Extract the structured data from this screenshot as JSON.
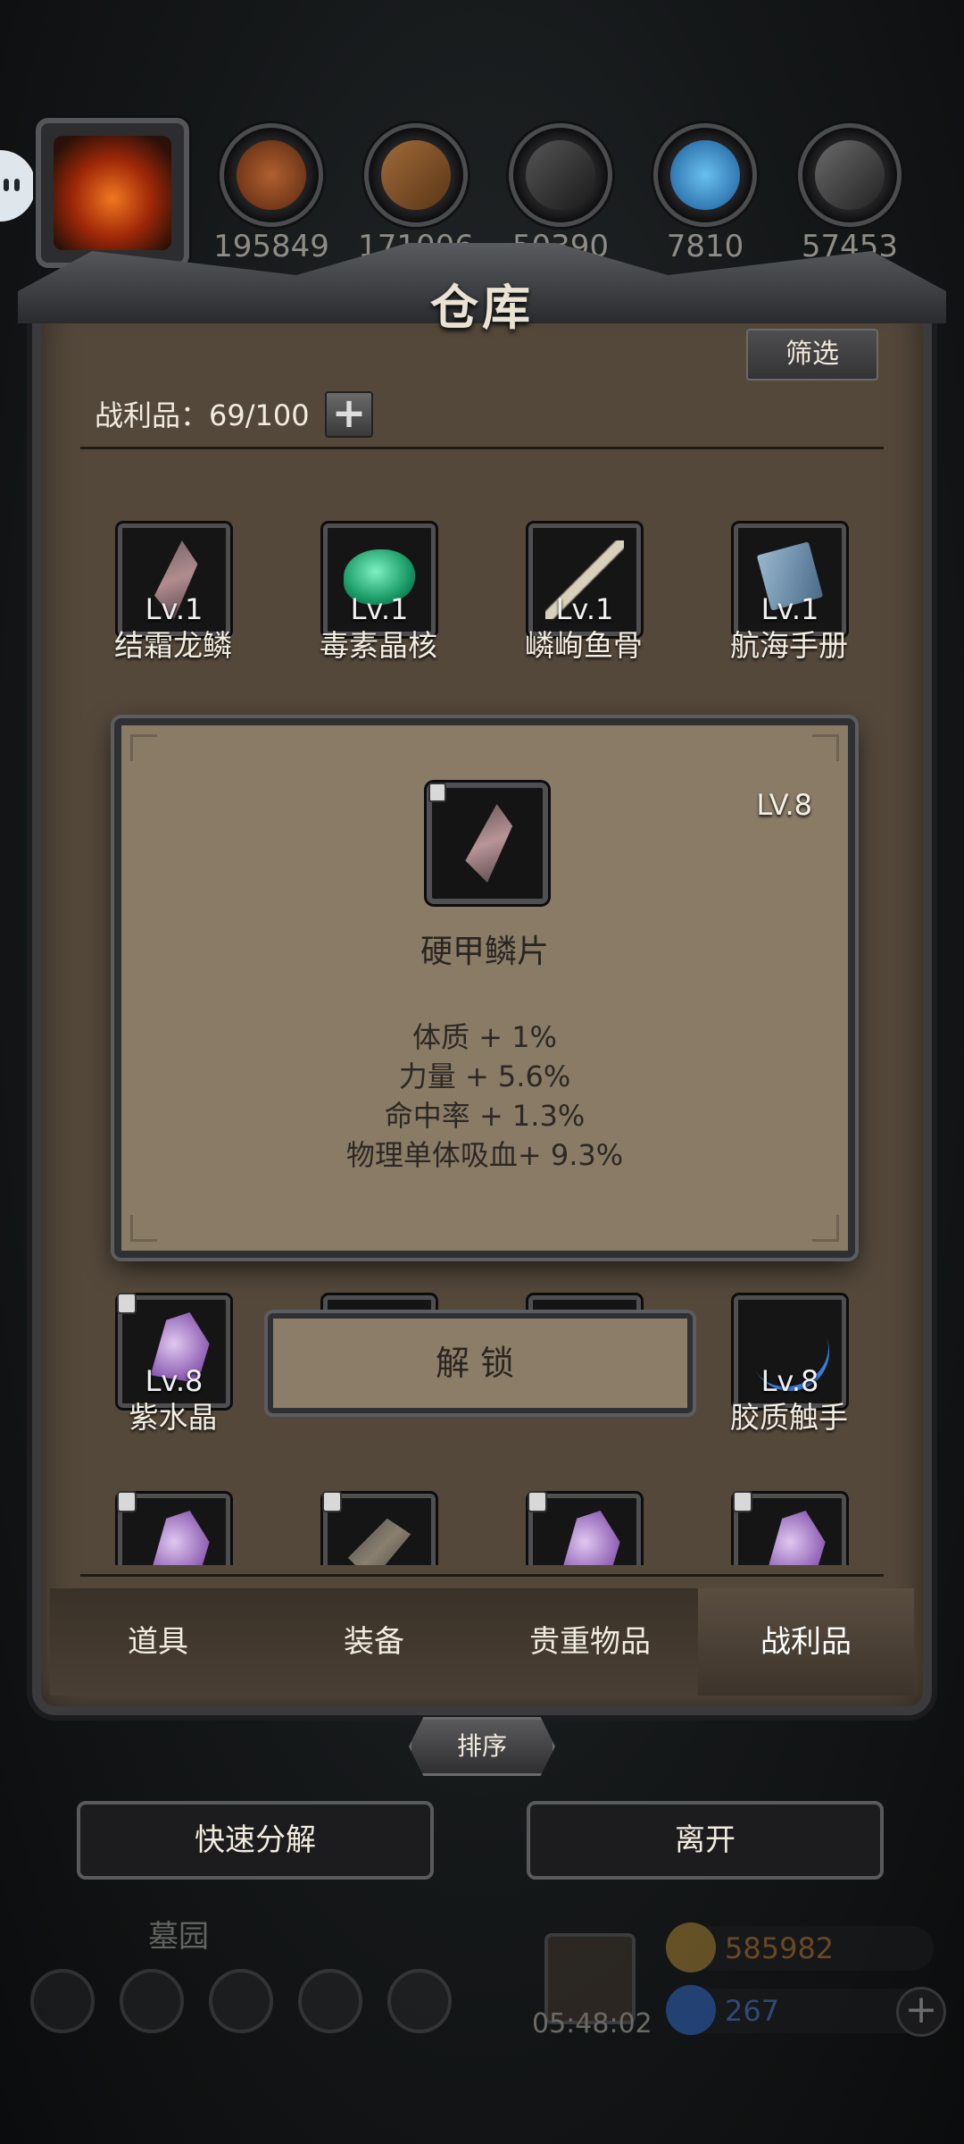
{
  "resources": [
    {
      "name": "wood-icon",
      "count": "195849",
      "color": "#a0522d"
    },
    {
      "name": "plank-icon",
      "count": "171006",
      "color": "#8b5a2b"
    },
    {
      "name": "iron-icon",
      "count": "50390",
      "color": "#666666"
    },
    {
      "name": "crystal-icon",
      "count": "7810",
      "color": "#3a8fd0"
    },
    {
      "name": "ingot-icon",
      "count": "57453",
      "color": "#5a5a5a"
    }
  ],
  "panel": {
    "title": "仓库",
    "filter_label": "筛选",
    "loot_count": "战利品：69/100"
  },
  "items_row1": [
    {
      "level": "Lv.1",
      "name": "结霜龙鳞",
      "icon": "scale-icon"
    },
    {
      "level": "Lv.1",
      "name": "毒素晶核",
      "icon": "jade-core-icon"
    },
    {
      "level": "Lv.1",
      "name": "嶙峋鱼骨",
      "icon": "fishbone-icon"
    },
    {
      "level": "Lv.1",
      "name": "航海手册",
      "icon": "book-icon"
    }
  ],
  "items_row3": [
    {
      "level": "Lv.8",
      "name": "紫水晶",
      "icon": "amethyst-icon"
    },
    {
      "level": "",
      "name": "",
      "icon": ""
    },
    {
      "level": "",
      "name": "",
      "icon": ""
    },
    {
      "level": "Lv.8",
      "name": "胶质触手",
      "icon": "tentacle-icon"
    }
  ],
  "tooltip": {
    "level": "LV.8",
    "name": "硬甲鳞片",
    "stats": [
      "体质 + 1%",
      "力量 + 5.6%",
      "命中率 + 1.3%",
      "物理单体吸血+ 9.3%"
    ]
  },
  "unlock_label": "解锁",
  "tabs": [
    "道具",
    "装备",
    "贵重物品",
    "战利品"
  ],
  "active_tab": "战利品",
  "sort_label": "排序",
  "quick_decompose_label": "快速分解",
  "leave_label": "离开",
  "hud": {
    "area_name": "墓园",
    "timer": "05:48:02",
    "gold": "585982",
    "gems": "267"
  },
  "colors": {
    "gold": "#c8782a",
    "gem": "#4a78d8",
    "panel": "#54483b"
  }
}
